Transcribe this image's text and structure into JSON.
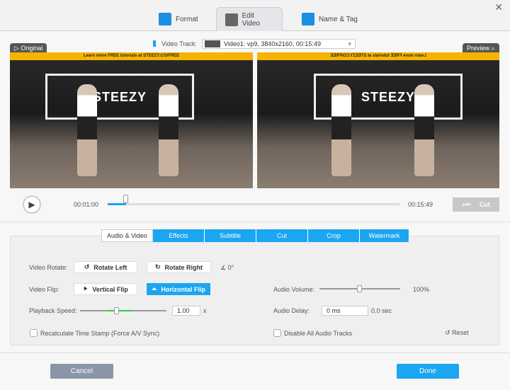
{
  "tabs": [
    {
      "label": "Format"
    },
    {
      "label": "Edit Video"
    },
    {
      "label": "Name & Tag"
    }
  ],
  "video_track": {
    "label": "Video Track:",
    "value": "Video1: vp9, 3840x2160, 00:15:49"
  },
  "original_label": "Original",
  "preview_label": "Preview",
  "banner_text": "Learn more FREE tutorials at STEEZY.CO/FREE",
  "sign_text": "STEEZY",
  "player": {
    "current_time": "00:01:00",
    "total_time": "00:15:49",
    "progress": 0.063,
    "cut_label": "Cut"
  },
  "subtabs": [
    "Audio & Video",
    "Effects",
    "Subtitle",
    "Cut",
    "Crop",
    "Watermark"
  ],
  "settings": {
    "rotate_label": "Video Rotate:",
    "rotate_left": "Rotate Left",
    "rotate_right": "Rotate Right",
    "angle": "0°",
    "flip_label": "Video Flip:",
    "vertical_flip": "Vertical Flip",
    "horizontal_flip": "Horizontal Flip",
    "speed_label": "Playback Speed:",
    "speed_value": "1.00",
    "speed_unit": "x",
    "recalc_label": "Recalculate Time Stamp (Force A/V Sync)",
    "volume_label": "Audio Volume:",
    "volume_value": "100%",
    "volume_fraction": 0.5,
    "delay_label": "Audio Delay:",
    "delay_value": "0 ms",
    "delay_sec": "0.0 sec",
    "disable_audio_label": "Disable All Audio Tracks",
    "reset_label": "Reset"
  },
  "footer": {
    "cancel": "Cancel",
    "done": "Done"
  },
  "colors": {
    "accent": "#1ca5f0",
    "banner": "#f5b400"
  }
}
